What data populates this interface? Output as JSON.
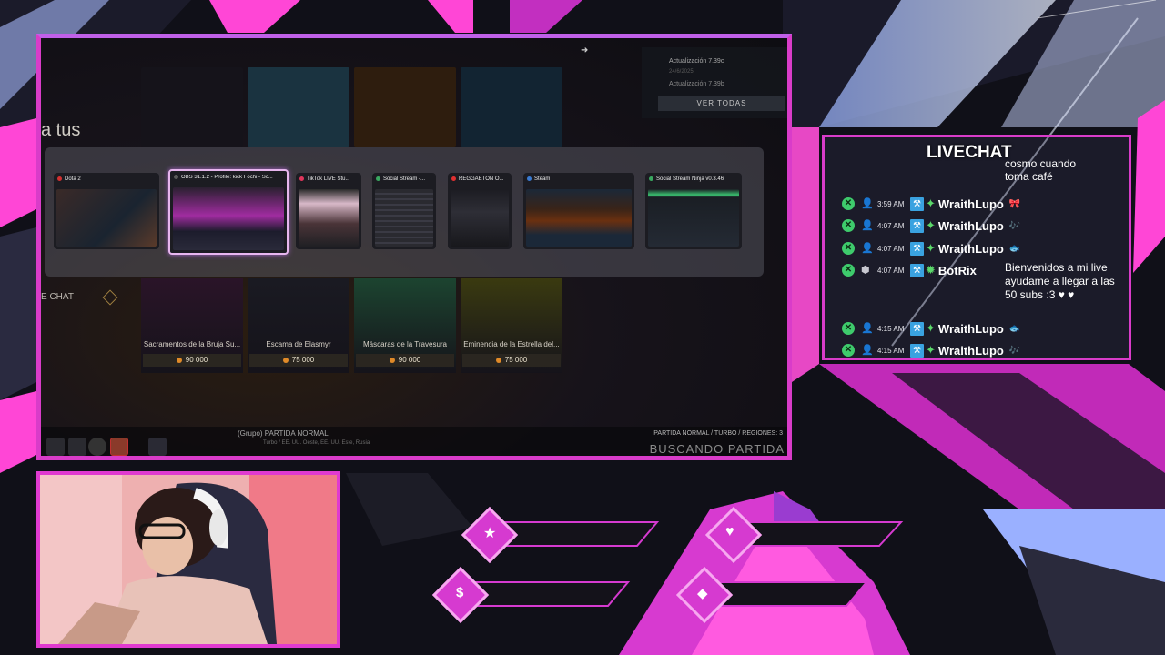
{
  "game": {
    "tus_text": "a tus",
    "chat_text": "E CHAT",
    "updates": {
      "line1": "Actualización 7.39c",
      "line2": "24/6/2025",
      "line3": "Actualización 7.39b",
      "button": "VER TODAS"
    },
    "shop_items": [
      {
        "title": "Sacramentos de la Bruja Su...",
        "price": "90 000"
      },
      {
        "title": "Escama de Elasmyr",
        "price": "75 000"
      },
      {
        "title": "Máscaras de la Travesura",
        "price": "90 000"
      },
      {
        "title": "Eminencia de la Estrella del...",
        "price": "75 000"
      }
    ],
    "windows": [
      {
        "title": "Dota 2",
        "dot_color": "#d23030"
      },
      {
        "title": "OBS 31.1.2 - Profile: kick Fochi - Sc...",
        "dot_color": "#5a5a5a"
      },
      {
        "title": "TikTok LIVE Stu...",
        "dot_color": "#e0365c"
      },
      {
        "title": "Social Stream -...",
        "dot_color": "#3aa860"
      },
      {
        "title": "REGGAETON O...",
        "dot_color": "#e03030"
      },
      {
        "title": "Steam",
        "dot_color": "#3a7ad0"
      },
      {
        "title": "Social Stream Ninja v0.3.46",
        "dot_color": "#3aa860"
      }
    ],
    "grupo": "(Grupo)   PARTIDA NORMAL",
    "turbo_line": "Turbo / EE. UU. Oeste, EE. UU. Este, Rusia",
    "partida_right": "PARTIDA NORMAL / TURBO / REGIONES: 3",
    "buscando": "BUSCANDO PARTIDA"
  },
  "chat": {
    "title": "LIVECHAT",
    "top_partial": "cosmo cuando\ntoma café",
    "messages": [
      {
        "time": "3:59 AM",
        "name": "WraithLupo",
        "emote": "🎀"
      },
      {
        "time": "4:07 AM",
        "name": "WraithLupo",
        "emote": "🎶"
      },
      {
        "time": "4:07 AM",
        "name": "WraithLupo",
        "emote": "🐟"
      },
      {
        "time": "4:07 AM",
        "name": "BotRix",
        "text": "Bienvenidos a mi live ayudame a llegar a las 50 subs :3 ♥ ♥"
      },
      {
        "time": "4:15 AM",
        "name": "WraithLupo",
        "emote": "🐟"
      },
      {
        "time": "4:15 AM",
        "name": "WraithLupo",
        "emote": "🎶"
      }
    ]
  },
  "colors": {
    "accent": "#e03ad0",
    "chat_green": "#3ecb6c",
    "badge_blue": "#3aa2e0"
  }
}
